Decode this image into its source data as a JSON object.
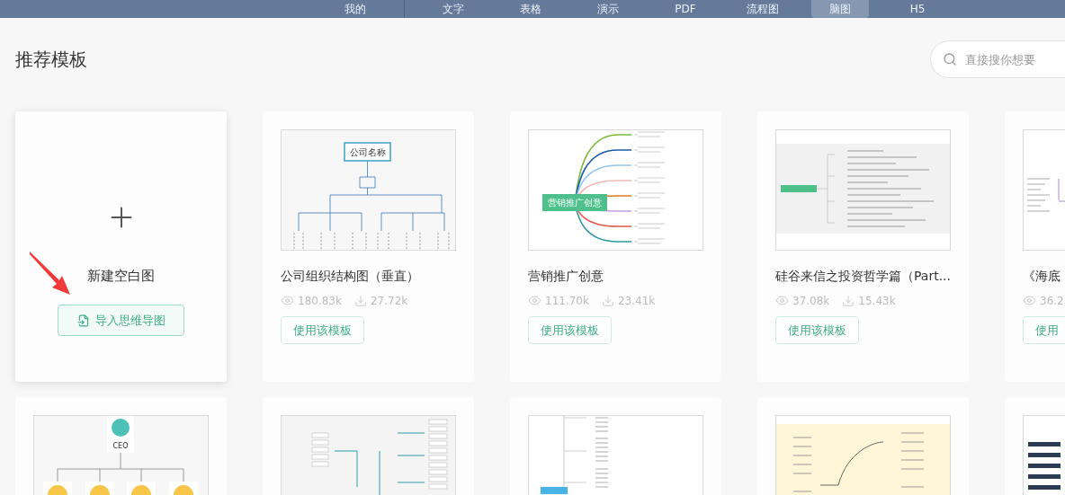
{
  "nav": {
    "items": [
      {
        "label": "我的",
        "selected": false
      },
      {
        "label": "文字",
        "selected": false
      },
      {
        "label": "表格",
        "selected": false
      },
      {
        "label": "演示",
        "selected": false
      },
      {
        "label": "PDF",
        "selected": false
      },
      {
        "label": "流程图",
        "selected": false
      },
      {
        "label": "脑图",
        "selected": true
      },
      {
        "label": "H5",
        "selected": false
      }
    ]
  },
  "section_title": "推荐模板",
  "search": {
    "placeholder": "直接搜你想要"
  },
  "new_card": {
    "label": "新建空白图",
    "import_button": "导入思维导图"
  },
  "templates": [
    {
      "title": "公司组织结构图（垂直）",
      "views": "180.83k",
      "downloads": "27.72k",
      "button": "使用该模板",
      "thumbnail": {
        "kind": "org_chart",
        "label": "公司名称"
      }
    },
    {
      "title": "营销推广创意",
      "views": "111.70k",
      "downloads": "23.41k",
      "button": "使用该模板",
      "thumbnail": {
        "kind": "mind_map",
        "label": "营销推广创意"
      }
    },
    {
      "title": "硅谷来信之投资哲学篇（Part...",
      "views": "37.08k",
      "downloads": "15.43k",
      "button": "使用该模板",
      "thumbnail": {
        "kind": "gray_outline"
      }
    },
    {
      "title": "《海底",
      "views": "36.2",
      "button": "使用",
      "thumbnail": {
        "kind": "sparse_outline"
      }
    }
  ],
  "more_templates": [
    {
      "thumbnail": {
        "kind": "people_chart",
        "label": "CEO"
      }
    },
    {
      "thumbnail": {
        "kind": "teal_tree"
      }
    },
    {
      "thumbnail": {
        "kind": "list_outline"
      }
    },
    {
      "thumbnail": {
        "kind": "yellow_map"
      }
    },
    {
      "thumbnail": {
        "kind": "dark_list"
      }
    }
  ]
}
